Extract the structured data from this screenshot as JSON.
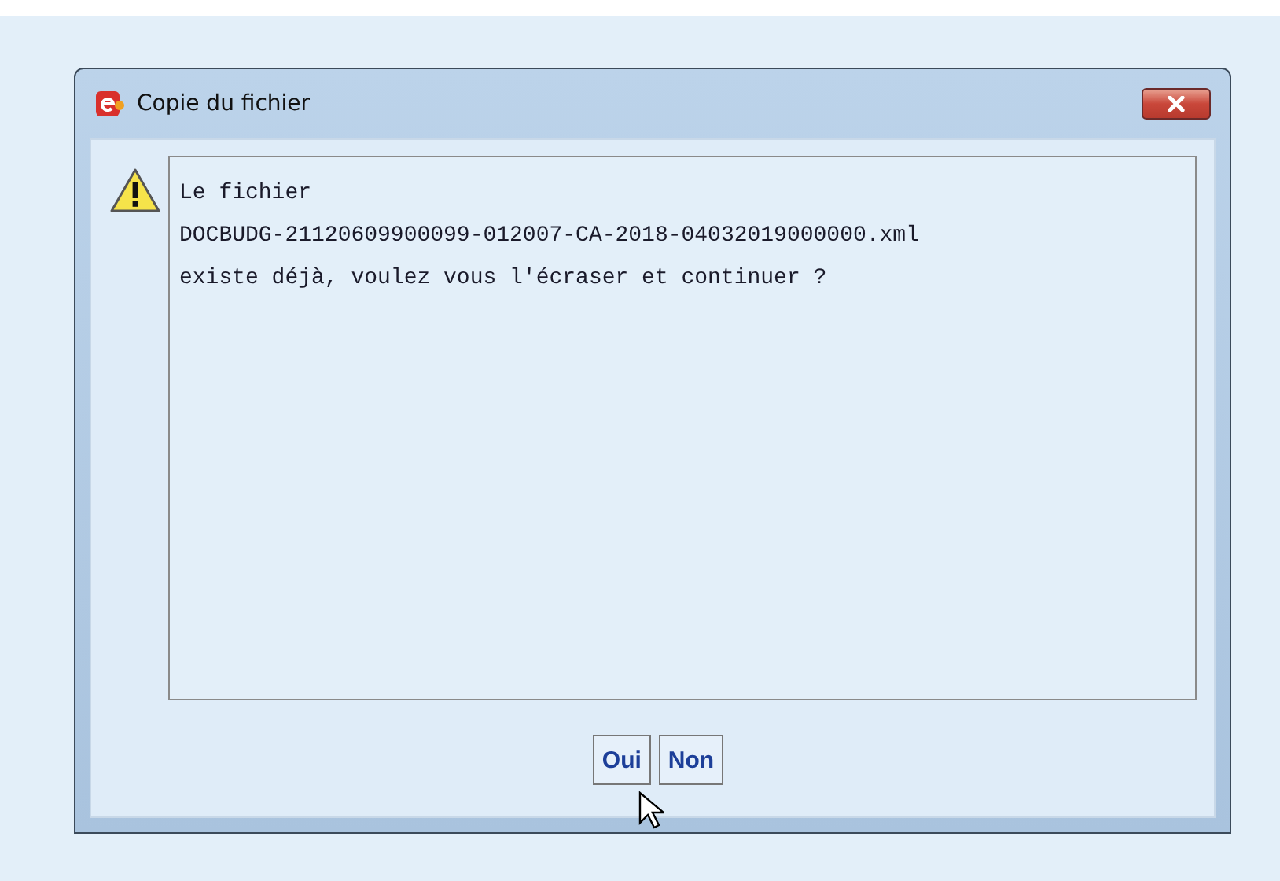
{
  "window": {
    "title": "Copie du fichier"
  },
  "message": {
    "lines": [
      "Le fichier",
      "DOCBUDG-21120609900099-012007-CA-2018-04032019000000.xml",
      "existe déjà, voulez vous l'écraser et continuer ?"
    ]
  },
  "buttons": [
    "Oui",
    "Non"
  ]
}
